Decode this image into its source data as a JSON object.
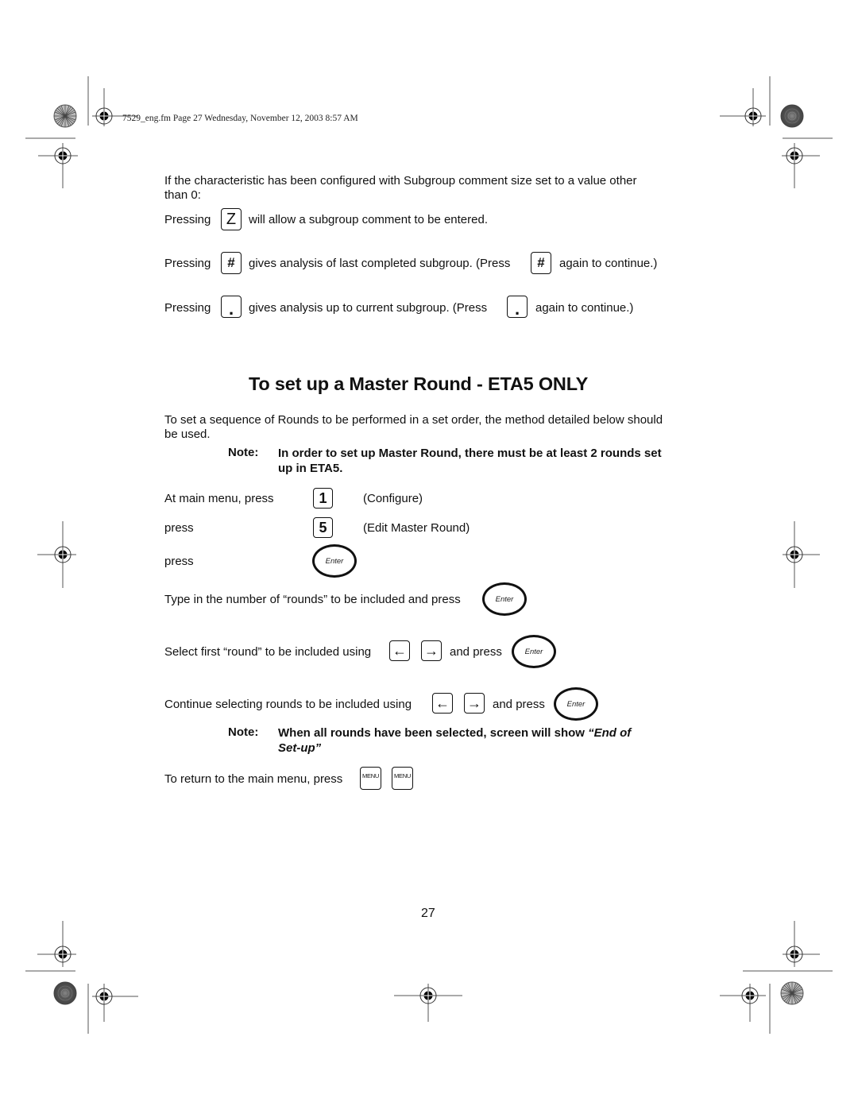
{
  "header": {
    "print_slug": "7529_eng.fm  Page 27  Wednesday, November 12, 2003  8:57 AM"
  },
  "intro": {
    "condition_line1": "If the characteristic has been configured with Subgroup comment size set to a value other",
    "condition_line2": "than 0:",
    "rows": [
      {
        "prefix": "Pressing",
        "key": "Z",
        "text": "will allow a subgroup comment to be entered."
      },
      {
        "prefix": "Pressing",
        "key": "#",
        "text": "gives analysis of last completed subgroup. (Press",
        "key2": "#",
        "suffix": "again to continue.)"
      },
      {
        "prefix": "Pressing",
        "key": ".",
        "text": "gives analysis up to current subgroup. (Press",
        "key2": ".",
        "suffix": "again to continue.)"
      }
    ]
  },
  "section": {
    "title": "To set up a Master Round - ETA5 ONLY",
    "paragraph_line1": "To set a sequence of Rounds to be performed in a set order, the method detailed below should",
    "paragraph_line2": "be used.",
    "note1": {
      "label": "Note:",
      "line1": "In order to set up Master Round, there must be at least 2 rounds set",
      "line2": "up in ETA5."
    },
    "steps": [
      {
        "label": "At main menu, press",
        "key": "1",
        "desc": "(Configure)"
      },
      {
        "label": "press",
        "key": "5",
        "desc": "(Edit Master Round)"
      },
      {
        "label": "press",
        "key": "Enter"
      }
    ],
    "type_rounds": {
      "text": "Type in the number of “rounds” to be included and press",
      "key": "Enter"
    },
    "select_first": {
      "text": "Select first “round” to be included using",
      "left_key": "←",
      "right_key": "→",
      "and_press": "and press",
      "key": "Enter"
    },
    "continue_select": {
      "text": "Continue selecting rounds to be included using",
      "left_key": "←",
      "right_key": "→",
      "and_press": "and press",
      "key": "Enter"
    },
    "note2": {
      "label": "Note:",
      "line1": "When all rounds have been selected, screen will show",
      "emph1": "“End of",
      "line2_emph": "Set-up”"
    },
    "return_menu": {
      "text": "To return to the main menu, press",
      "key": "MENU",
      "key2": "MENU"
    }
  },
  "footer": {
    "page_number": "27"
  },
  "print_marks": {
    "registration_icon": "crosshair-target-icon",
    "color_bar_icon": "starburst-disc-icon",
    "gray_disc_icon": "gray-disc-icon"
  }
}
